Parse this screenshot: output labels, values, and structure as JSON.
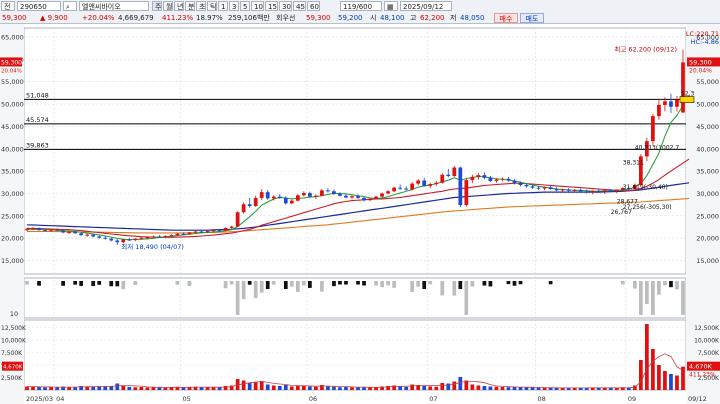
{
  "toolbar": {
    "mode": "전",
    "code": "290650",
    "name": "엘앤씨바이오",
    "period_buttons": [
      "주",
      "월",
      "년",
      "분",
      "초",
      "틱",
      "1",
      "3",
      "5",
      "10",
      "15",
      "30",
      "45",
      "60"
    ],
    "bar_count": "119/600",
    "date": "2025/09/12",
    "price": "59,300",
    "change": "9,900",
    "change_pct": "+20.04%",
    "volume": "4,669,679",
    "volume_ratio": "411.23%",
    "turnover": "18.97%",
    "amount": "259,106백만",
    "share_label": "회우선",
    "prev_label": "59,300",
    "ask": "59,200",
    "open_label": "시",
    "open": "48,100",
    "high_label": "고",
    "high": "62,200",
    "low_label": "저",
    "low": "48,050",
    "buy_label": "매수",
    "sell_label": "매도"
  },
  "colors": {
    "up": "#e01010",
    "down": "#1c49d6",
    "ma5": "#1e9b2c",
    "ma20": "#c81c2d",
    "ma60": "#1c2a9c",
    "ma120": "#e07a1c"
  },
  "price_axis": {
    "ticks": [
      15000,
      20000,
      25000,
      30000,
      35000,
      40000,
      45000,
      50000,
      55000,
      60000,
      65000
    ],
    "labels": [
      "15,000",
      "20,000",
      "25,000",
      "30,000",
      "35,000",
      "40,000",
      "45,000",
      "50,000",
      "55,000",
      "60,000",
      "65,000"
    ],
    "min": 12000,
    "max": 67000
  },
  "hlines": [
    {
      "value": 51048,
      "label": "51,048"
    },
    {
      "value": 45574,
      "label": "45,574"
    },
    {
      "value": 39863,
      "label": "39,863"
    }
  ],
  "annotations": {
    "high": "최고 62,200 (09/12)",
    "low": "최저 18,490 (04/07)",
    "right_top1": "LC:220.71",
    "right_top2": "HC:-4.86",
    "price_tag": "59,300",
    "price_tag_pct": "20.04%",
    "ann1": "40,313(1002,7",
    "ann2": "38,311",
    "ann3": "31,419(-30,40)",
    "ann4": "28,677",
    "ann5": "27,256(-305,30)",
    "ann6": "26,767",
    "ann7": "52,3"
  },
  "vol_axis": {
    "labels": [
      "12,500K",
      "10,000K",
      "7,500K",
      "5,000K",
      "2,500K"
    ],
    "values": [
      12500,
      10000,
      7500,
      5000,
      2500
    ],
    "max": 14000
  },
  "vol_tags": {
    "v1": "4,670K",
    "v2": "411.23%"
  },
  "osc_label": "10",
  "x_labels": [
    "2025/03",
    "04",
    "05",
    "06",
    "07",
    "08",
    "09",
    "09/12"
  ],
  "chart_data": {
    "type": "candlestick",
    "period": "2025/03 – 2025/09/12",
    "candles": [
      [
        21800,
        22300,
        21600,
        22100,
        700
      ],
      [
        22100,
        22500,
        21900,
        22200,
        650
      ],
      [
        22200,
        22400,
        21700,
        21800,
        600
      ],
      [
        21800,
        22100,
        21500,
        21700,
        550
      ],
      [
        21700,
        22000,
        21400,
        21900,
        600
      ],
      [
        21900,
        22200,
        21600,
        21700,
        500
      ],
      [
        21700,
        21900,
        21100,
        21300,
        700
      ],
      [
        21300,
        21600,
        20900,
        21400,
        600
      ],
      [
        21400,
        21700,
        21000,
        21100,
        550
      ],
      [
        21100,
        21300,
        20500,
        20700,
        800
      ],
      [
        20700,
        21000,
        20300,
        20800,
        650
      ],
      [
        20800,
        21000,
        20200,
        20400,
        700
      ],
      [
        20400,
        20700,
        19900,
        20100,
        750
      ],
      [
        20100,
        20400,
        19700,
        19900,
        700
      ],
      [
        19900,
        20100,
        19300,
        19500,
        800
      ],
      [
        19500,
        19800,
        18490,
        19100,
        1300
      ],
      [
        19100,
        19900,
        18900,
        19700,
        900
      ],
      [
        19700,
        20100,
        19400,
        19600,
        600
      ],
      [
        19600,
        20000,
        19300,
        19900,
        550
      ],
      [
        19900,
        20300,
        19700,
        20100,
        600
      ],
      [
        20100,
        20400,
        19800,
        20200,
        500
      ],
      [
        20200,
        20600,
        20000,
        20400,
        550
      ],
      [
        20400,
        20700,
        20100,
        20300,
        500
      ],
      [
        20300,
        20600,
        20000,
        20500,
        450
      ],
      [
        20500,
        20900,
        20300,
        20700,
        550
      ],
      [
        20700,
        21200,
        20500,
        21000,
        650
      ],
      [
        21000,
        21300,
        20700,
        20900,
        500
      ],
      [
        20900,
        21400,
        20800,
        21300,
        600
      ],
      [
        21300,
        21700,
        21100,
        21500,
        650
      ],
      [
        21500,
        21800,
        21200,
        21400,
        500
      ],
      [
        21400,
        21700,
        21100,
        21600,
        550
      ],
      [
        21600,
        22000,
        21400,
        21800,
        600
      ],
      [
        21800,
        22100,
        21500,
        21700,
        500
      ],
      [
        21700,
        22400,
        21600,
        22300,
        800
      ],
      [
        22300,
        22800,
        22100,
        22600,
        900
      ],
      [
        22600,
        26000,
        22500,
        25800,
        2200
      ],
      [
        25800,
        28000,
        25500,
        27600,
        1900
      ],
      [
        27600,
        29000,
        26800,
        27200,
        1400
      ],
      [
        27200,
        29500,
        27000,
        29000,
        1500
      ],
      [
        29000,
        31000,
        28500,
        30300,
        1700
      ],
      [
        30300,
        30800,
        28600,
        28900,
        1100
      ],
      [
        28900,
        29600,
        28400,
        29300,
        900
      ],
      [
        29300,
        29900,
        28800,
        29000,
        800
      ],
      [
        29000,
        29400,
        27500,
        27800,
        1000
      ],
      [
        27800,
        28700,
        27600,
        28400,
        700
      ],
      [
        28400,
        29800,
        28200,
        29600,
        900
      ],
      [
        29600,
        30500,
        29300,
        30100,
        800
      ],
      [
        30100,
        30400,
        29100,
        29300,
        700
      ],
      [
        29300,
        29800,
        28800,
        29500,
        650
      ],
      [
        29500,
        31000,
        29400,
        30700,
        1000
      ],
      [
        30700,
        31200,
        30200,
        30500,
        700
      ],
      [
        30500,
        30900,
        29700,
        29900,
        650
      ],
      [
        29900,
        30300,
        29300,
        29500,
        550
      ],
      [
        29500,
        30000,
        28900,
        29100,
        600
      ],
      [
        29100,
        29600,
        28700,
        29400,
        550
      ],
      [
        29400,
        29800,
        28800,
        29000,
        500
      ],
      [
        29000,
        29300,
        28200,
        28500,
        600
      ],
      [
        28500,
        29000,
        28300,
        28800,
        500
      ],
      [
        28800,
        29500,
        28700,
        29300,
        600
      ],
      [
        29300,
        30200,
        29100,
        30000,
        700
      ],
      [
        30000,
        30800,
        29800,
        30500,
        800
      ],
      [
        30500,
        31500,
        30300,
        31300,
        900
      ],
      [
        31300,
        32000,
        30800,
        31100,
        700
      ],
      [
        31100,
        31600,
        30600,
        30900,
        600
      ],
      [
        30900,
        32500,
        30700,
        32200,
        1100
      ],
      [
        32200,
        33200,
        31800,
        32900,
        1000
      ],
      [
        32900,
        33500,
        31500,
        31700,
        900
      ],
      [
        31700,
        32400,
        31200,
        32100,
        700
      ],
      [
        32100,
        32800,
        31700,
        32400,
        650
      ],
      [
        32400,
        34500,
        32200,
        34200,
        1400
      ],
      [
        34200,
        35500,
        33600,
        33900,
        1300
      ],
      [
        33900,
        36200,
        33700,
        35800,
        1700
      ],
      [
        35800,
        36000,
        27000,
        27400,
        2600
      ],
      [
        27400,
        33500,
        27100,
        33000,
        1900
      ],
      [
        33000,
        34200,
        32300,
        33700,
        1100
      ],
      [
        33700,
        34600,
        33100,
        34100,
        900
      ],
      [
        34100,
        34700,
        33200,
        33500,
        800
      ],
      [
        33500,
        33900,
        32600,
        32800,
        700
      ],
      [
        32800,
        33400,
        32400,
        33100,
        650
      ],
      [
        33100,
        33600,
        32700,
        33300,
        600
      ],
      [
        33300,
        33700,
        32600,
        32900,
        550
      ],
      [
        32900,
        33200,
        32000,
        32300,
        600
      ],
      [
        32300,
        32700,
        31600,
        31900,
        550
      ],
      [
        31900,
        32300,
        31300,
        31600,
        500
      ],
      [
        31600,
        32000,
        31000,
        31300,
        500
      ],
      [
        31300,
        31700,
        30800,
        31100,
        450
      ],
      [
        31100,
        31600,
        30700,
        31400,
        450
      ],
      [
        31400,
        31800,
        30900,
        31000,
        400
      ],
      [
        31000,
        31400,
        30500,
        30700,
        450
      ],
      [
        30700,
        31100,
        30300,
        30900,
        400
      ],
      [
        30900,
        31200,
        30400,
        30600,
        400
      ],
      [
        30600,
        31000,
        30200,
        30800,
        400
      ],
      [
        30800,
        31100,
        30300,
        30500,
        450
      ],
      [
        30500,
        30900,
        30000,
        30300,
        500
      ],
      [
        30300,
        30700,
        29800,
        30600,
        450
      ],
      [
        30600,
        31000,
        30200,
        30400,
        400
      ],
      [
        30400,
        30800,
        29900,
        30700,
        450
      ],
      [
        30700,
        31000,
        30200,
        30500,
        400
      ],
      [
        30500,
        30900,
        30100,
        30800,
        400
      ],
      [
        30800,
        31400,
        30500,
        31200,
        550
      ],
      [
        31200,
        31600,
        30700,
        31000,
        500
      ],
      [
        31000,
        32200,
        30900,
        31900,
        900
      ],
      [
        31900,
        38800,
        31700,
        38300,
        6000
      ],
      [
        38300,
        42500,
        37200,
        41700,
        13200
      ],
      [
        41700,
        47800,
        40900,
        47300,
        8200
      ],
      [
        47300,
        51200,
        46500,
        49800,
        5000
      ],
      [
        49800,
        51500,
        48400,
        50600,
        3800
      ],
      [
        50600,
        52300,
        48000,
        49400,
        3200
      ],
      [
        49400,
        51800,
        48300,
        51000,
        2900
      ],
      [
        48100,
        62200,
        48050,
        59300,
        4670
      ]
    ],
    "ma5": [
      22000,
      22000,
      21950,
      21900,
      21900,
      21800,
      21700,
      21600,
      21500,
      21350,
      21150,
      20950,
      20750,
      20500,
      20250,
      19950,
      19750,
      19700,
      19700,
      19750,
      19850,
      20000,
      20150,
      20300,
      20450,
      20600,
      20750,
      20900,
      21050,
      21200,
      21300,
      21400,
      21500,
      21650,
      21900,
      22600,
      23700,
      24800,
      26000,
      27400,
      28100,
      28800,
      29100,
      29000,
      28800,
      28900,
      29000,
      29200,
      29300,
      29500,
      29800,
      30000,
      30000,
      29900,
      29700,
      29500,
      29300,
      29000,
      28900,
      29000,
      29300,
      29700,
      30100,
      30500,
      30900,
      31400,
      31700,
      31900,
      32200,
      32600,
      33000,
      33500,
      33000,
      33300,
      33600,
      33800,
      33700,
      33500,
      33300,
      33200,
      33000,
      32800,
      32500,
      32200,
      31900,
      31600,
      31400,
      31200,
      31000,
      30900,
      30800,
      30700,
      30700,
      30600,
      30500,
      30500,
      30600,
      30600,
      30650,
      30800,
      31000,
      31400,
      32300,
      34000,
      36500,
      39000,
      42800,
      45900,
      47500,
      49700,
      52000
    ],
    "ma20": [
      22200,
      22200,
      22150,
      22100,
      22050,
      22000,
      21950,
      21900,
      21800,
      21700,
      21550,
      21400,
      21250,
      21100,
      20950,
      20800,
      20650,
      20550,
      20450,
      20350,
      20300,
      20250,
      20200,
      20200,
      20200,
      20250,
      20300,
      20350,
      20400,
      20500,
      20600,
      20700,
      20850,
      21000,
      21150,
      21400,
      21700,
      22000,
      22400,
      22900,
      23300,
      23700,
      24100,
      24500,
      24900,
      25300,
      25700,
      26100,
      26500,
      26900,
      27300,
      27700,
      28000,
      28200,
      28400,
      28500,
      28600,
      28700,
      28800,
      28800,
      28900,
      29000,
      29100,
      29300,
      29500,
      29700,
      29900,
      30100,
      30300,
      30500,
      30800,
      31000,
      31100,
      31200,
      31400,
      31600,
      31800,
      31900,
      32000,
      32100,
      32200,
      32300,
      32300,
      32200,
      32100,
      32000,
      31900,
      31800,
      31700,
      31600,
      31500,
      31400,
      31300,
      31200,
      31100,
      31000,
      30900,
      30800,
      30750,
      30700,
      30700,
      30800,
      31100,
      31600,
      32300,
      33100,
      34100,
      35000,
      35900,
      36800,
      37700
    ],
    "ma60": [
      23000,
      22950,
      22900,
      22850,
      22800,
      22750,
      22700,
      22650,
      22600,
      22550,
      22500,
      22450,
      22400,
      22350,
      22300,
      22250,
      22200,
      22150,
      22100,
      22050,
      22000,
      21950,
      21900,
      21850,
      21800,
      21800,
      21800,
      21800,
      21800,
      21800,
      21800,
      21850,
      21900,
      21950,
      22000,
      22100,
      22200,
      22350,
      22500,
      22700,
      22900,
      23100,
      23300,
      23500,
      23700,
      23900,
      24100,
      24300,
      24500,
      24700,
      24900,
      25100,
      25300,
      25500,
      25700,
      25900,
      26100,
      26300,
      26500,
      26700,
      26900,
      27100,
      27300,
      27500,
      27700,
      27900,
      28100,
      28300,
      28500,
      28700,
      28900,
      29100,
      29200,
      29300,
      29400,
      29500,
      29600,
      29700,
      29800,
      29900,
      30000,
      30050,
      30100,
      30150,
      30200,
      30250,
      30300,
      30300,
      30300,
      30300,
      30300,
      30300,
      30300,
      30300,
      30300,
      30300,
      30350,
      30400,
      30450,
      30500,
      30600,
      30700,
      30800,
      31000,
      31200,
      31400,
      31600,
      31800,
      32000,
      32200,
      32400
    ],
    "ma120": [
      21500,
      21500,
      21500,
      21500,
      21500,
      21480,
      21460,
      21440,
      21420,
      21400,
      21380,
      21360,
      21340,
      21320,
      21300,
      21280,
      21260,
      21240,
      21220,
      21200,
      21200,
      21200,
      21200,
      21200,
      21200,
      21200,
      21200,
      21220,
      21240,
      21260,
      21280,
      21300,
      21350,
      21400,
      21450,
      21500,
      21600,
      21700,
      21800,
      21900,
      22000,
      22100,
      22200,
      22300,
      22400,
      22500,
      22600,
      22700,
      22800,
      22900,
      23000,
      23150,
      23300,
      23450,
      23600,
      23750,
      23900,
      24050,
      24200,
      24350,
      24500,
      24650,
      24800,
      24950,
      25100,
      25250,
      25400,
      25550,
      25700,
      25850,
      26000,
      26100,
      26200,
      26300,
      26400,
      26500,
      26600,
      26700,
      26800,
      26900,
      27000,
      27050,
      27100,
      27150,
      27200,
      27250,
      27300,
      27350,
      27400,
      27450,
      27500,
      27550,
      27600,
      27650,
      27700,
      27750,
      27800,
      27850,
      27900,
      27950,
      28000,
      28050,
      28100,
      28200,
      28300,
      28400,
      28500,
      28600,
      28700,
      28800,
      28900
    ]
  }
}
